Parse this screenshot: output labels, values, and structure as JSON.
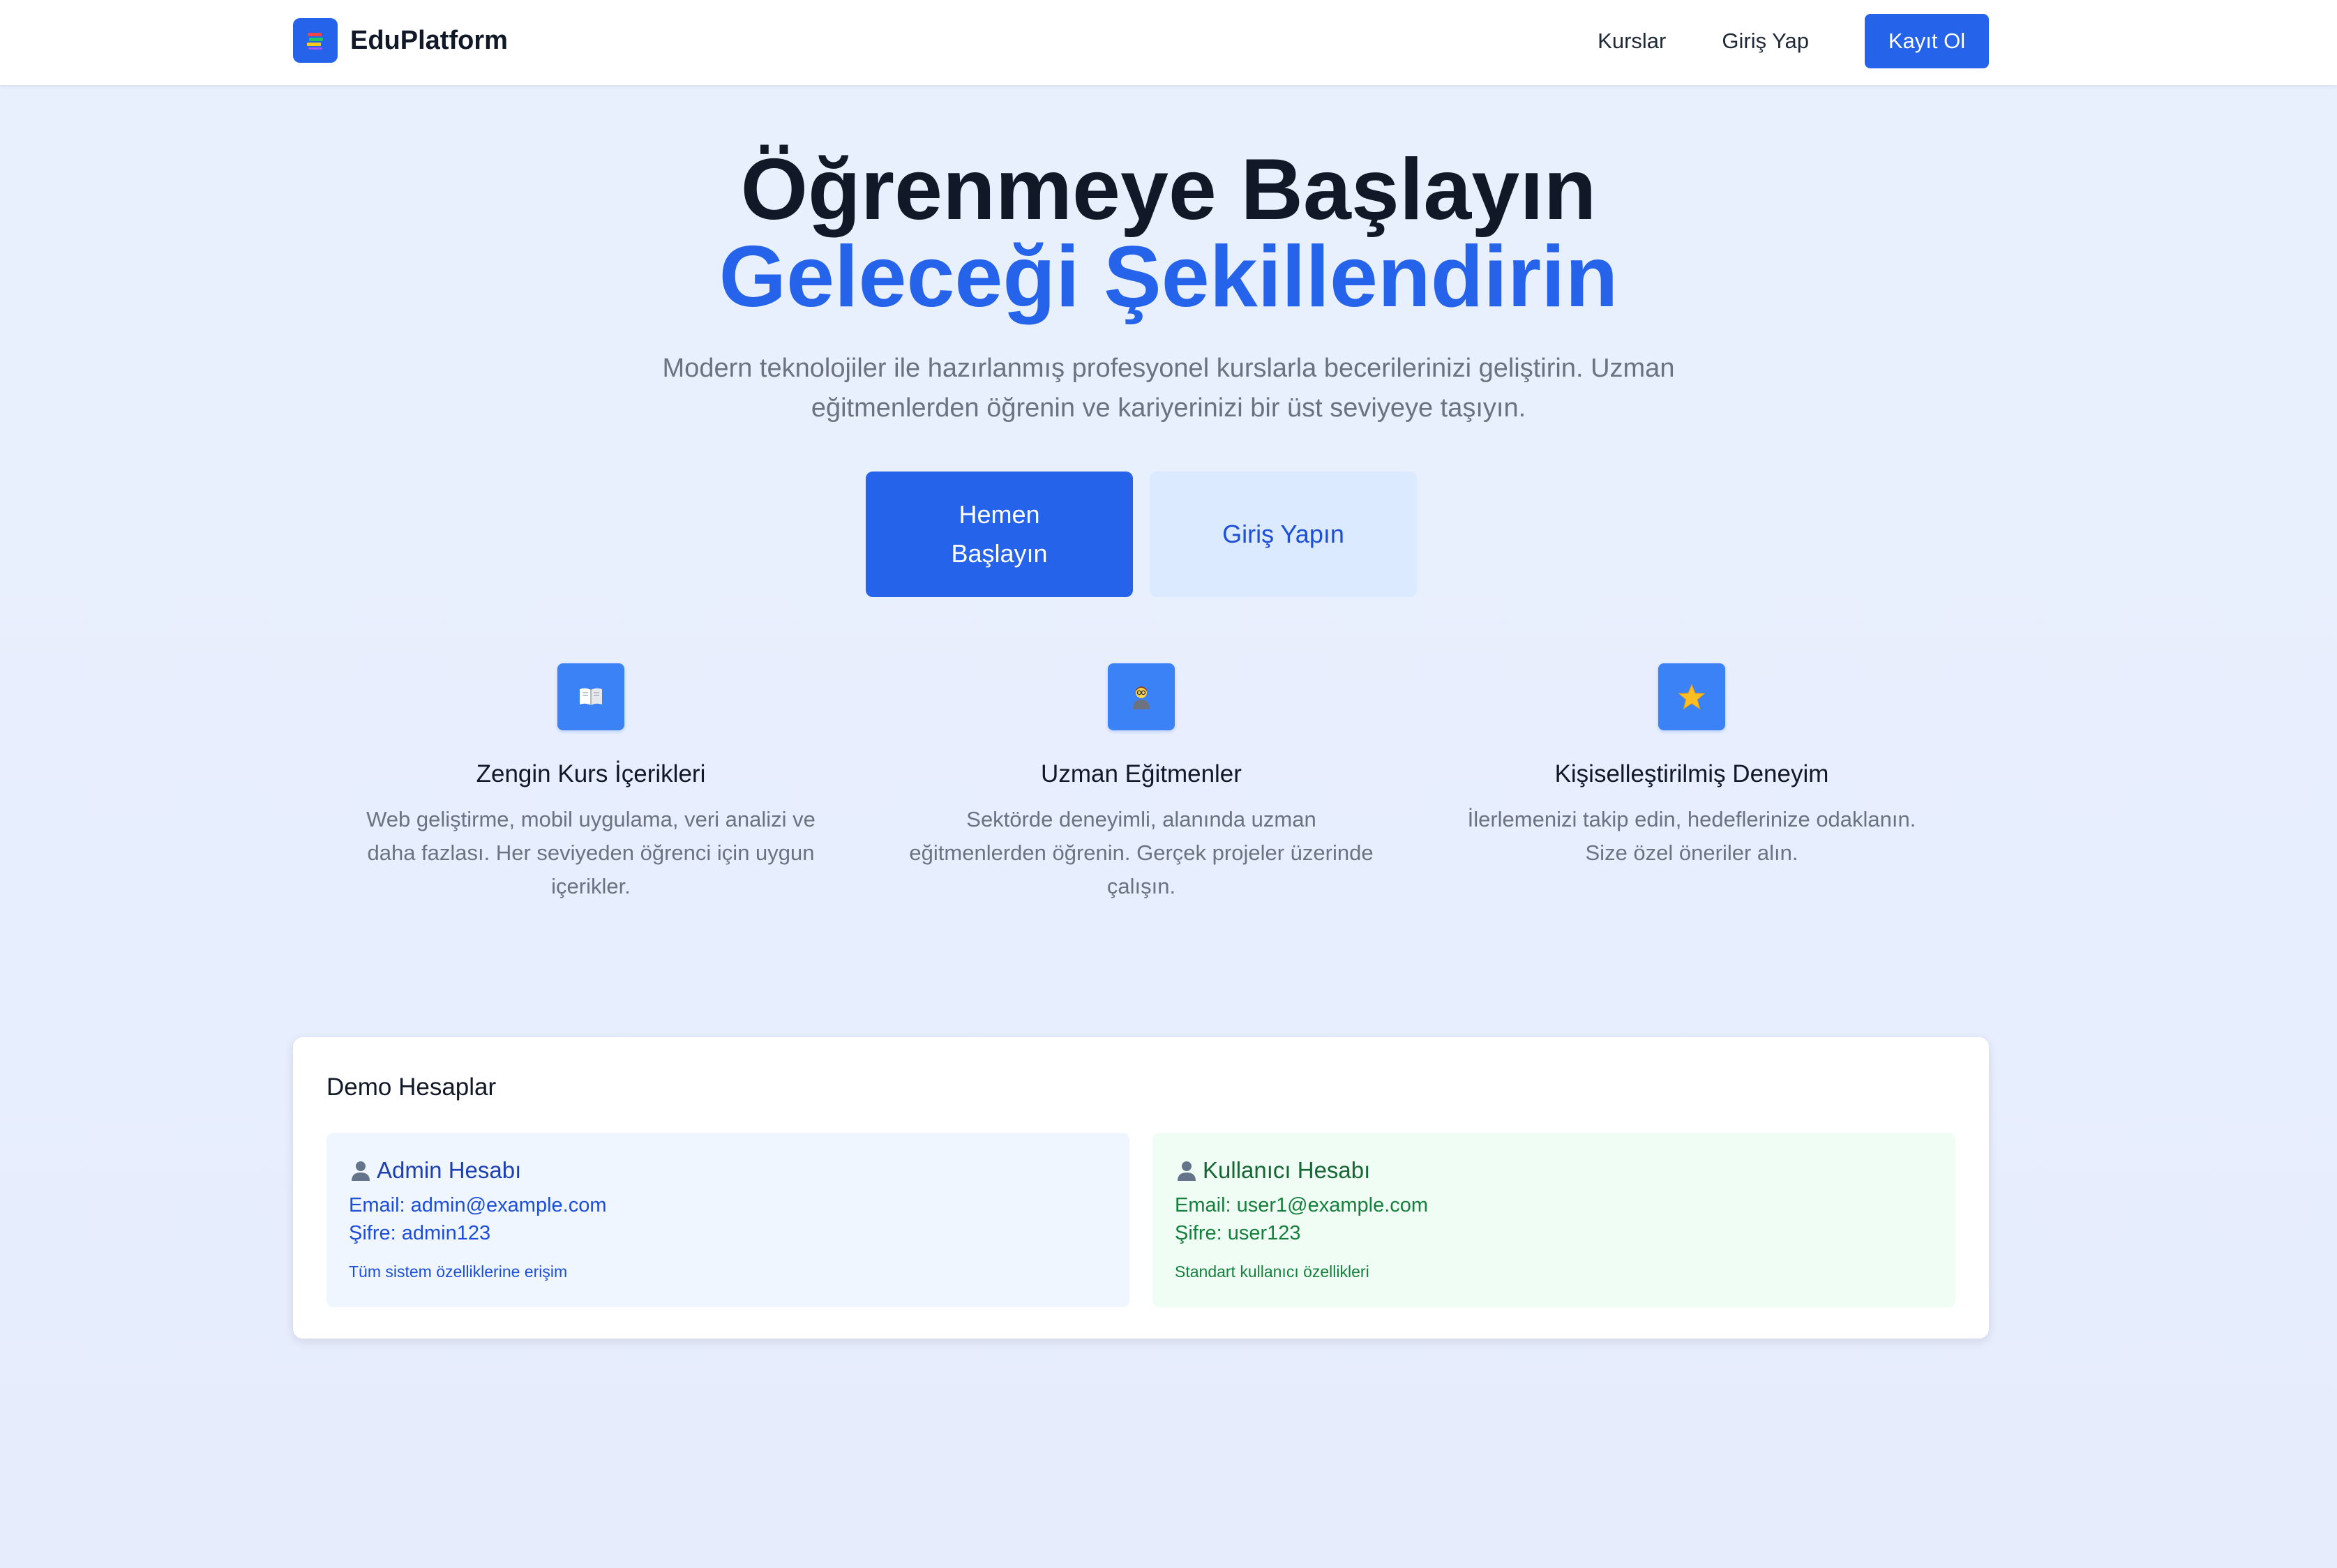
{
  "header": {
    "brand_name": "EduPlatform",
    "logo_icon": "books-icon",
    "nav": {
      "courses": "Kurslar",
      "login": "Giriş Yap",
      "register": "Kayıt Ol"
    }
  },
  "hero": {
    "title_line1": "Öğrenmeye Başlayın",
    "title_line2": "Geleceği Şekillendirin",
    "subtitle": "Modern teknolojiler ile hazırlanmış profesyonel kurslarla becerilerinizi geliştirin. Uzman eğitmenlerden öğrenin ve kariyerinizi bir üst seviyeye taşıyın.",
    "primary_button": "Hemen Başlayın",
    "secondary_button": "Giriş Yapın"
  },
  "features": [
    {
      "icon": "book-icon",
      "title": "Zengin Kurs İçerikleri",
      "description": "Web geliştirme, mobil uygulama, veri analizi ve daha fazlası. Her seviyeden öğrenci için uygun içerikler."
    },
    {
      "icon": "teacher-icon",
      "title": "Uzman Eğitmenler",
      "description": "Sektörde deneyimli, alanında uzman eğitmenlerden öğrenin. Gerçek projeler üzerinde çalışın."
    },
    {
      "icon": "star-icon",
      "title": "Kişiselleştirilmiş Deneyim",
      "description": "İlerlemenizi takip edin, hedeflerinize odaklanın. Size özel öneriler alın."
    }
  ],
  "demo": {
    "title": "Demo Hesaplar",
    "admin": {
      "heading": "Admin Hesabı",
      "email": "Email: admin@example.com",
      "password": "Şifre: admin123",
      "note": "Tüm sistem özelliklerine erişim"
    },
    "user": {
      "heading": "Kullanıcı Hesabı",
      "email": "Email: user1@example.com",
      "password": "Şifre: user123",
      "note": "Standart kullanıcı özellikleri"
    }
  },
  "colors": {
    "primary": "#2563eb",
    "feature_icon_bg": "#3b82f6",
    "secondary_button_bg": "#dbeafe",
    "admin_box_bg": "#eff6ff",
    "user_box_bg": "#f0fdf4"
  }
}
